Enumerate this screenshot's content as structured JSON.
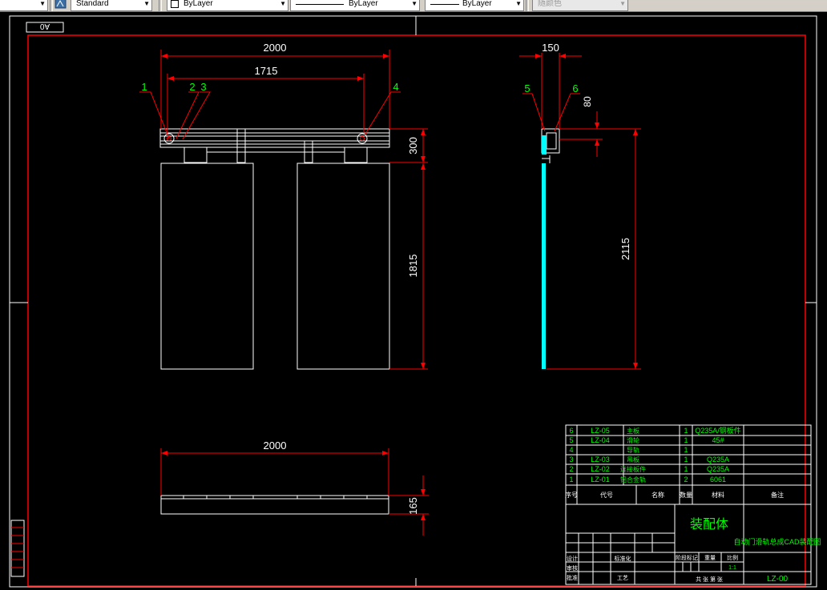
{
  "toolbar": {
    "text_style": "Standard",
    "layer_color": "ByLayer",
    "linetype": "ByLayer",
    "lineweight": "ByLayer",
    "plot_style": "随颜色"
  },
  "view": {
    "corner_label": "A0"
  },
  "front_view": {
    "dim_width": "2000",
    "dim_inner": "1715",
    "dim_rail": "300",
    "dim_panel": "1815",
    "balloons": [
      "1",
      "2",
      "3",
      "4"
    ]
  },
  "side_view": {
    "dim_width": "150",
    "dim_small": "80",
    "dim_height": "2115",
    "balloons": [
      "5",
      "6"
    ]
  },
  "top_view": {
    "dim_width": "2000",
    "dim_height": "165"
  },
  "bom": {
    "rows": [
      {
        "no": "6",
        "code": "LZ-05",
        "name": "主板",
        "qty": "1",
        "material": "Q235A/钢板件"
      },
      {
        "no": "5",
        "code": "LZ-04",
        "name": "滑轮",
        "qty": "1",
        "material": "45#"
      },
      {
        "no": "4",
        "code": "",
        "name": "导轨",
        "qty": "1",
        "material": ""
      },
      {
        "no": "3",
        "code": "LZ-03",
        "name": "吊板",
        "qty": "1",
        "material": "Q235A"
      },
      {
        "no": "2",
        "code": "LZ-02",
        "name": "连接板件",
        "qty": "1",
        "material": "Q235A"
      },
      {
        "no": "1",
        "code": "LZ-01",
        "name": "铝合金轨",
        "qty": "2",
        "material": "6061"
      }
    ],
    "header": {
      "no": "序号",
      "code": "代号",
      "name": "名称",
      "qty": "数量",
      "material": "材料",
      "remark": "备注"
    }
  },
  "title_block": {
    "assembly": "装配体",
    "title": "自动门滑轨总成CAD装配图",
    "drawing_no": "LZ-00",
    "design": "设计",
    "check": "审核",
    "approve": "批准",
    "process": "工艺",
    "standard": "标准化",
    "scale_label": "比例",
    "weight_label": "重量",
    "stage_label": "阶段标记",
    "sheet_label": "共 张 第 张",
    "scale_value": "1:1"
  },
  "colors": {
    "background": "#000000",
    "geometry": "#ffffff",
    "dimension": "#ff0000",
    "text": "#ffffff",
    "balloon": "#00ff00",
    "section": "#00ffff",
    "table_text": "#00ff00"
  }
}
